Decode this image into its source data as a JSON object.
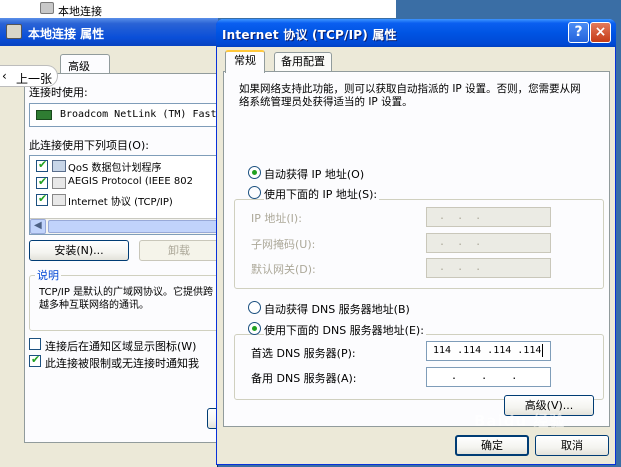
{
  "background_window": {
    "top_item": "本地连接",
    "title": "本地连接 属性",
    "back_button": "上一张",
    "tab_advanced": "高级",
    "connect_using_label": "连接时使用:",
    "adapter": "Broadcom NetLink (TM) Fast",
    "items_label": "此连接使用下列项目(O):",
    "items": [
      {
        "label": "QoS 数据包计划程序",
        "checked": true
      },
      {
        "label": "AEGIS Protocol (IEEE 802",
        "checked": true
      },
      {
        "label": "Internet 协议 (TCP/IP)",
        "checked": true
      }
    ],
    "install_button": "安装(N)...",
    "uninstall_button": "卸载",
    "description_group": "说明",
    "description_text": "TCP/IP 是默认的广域网协议。它提供跨越多种互联网络的通讯。",
    "show_icon_checkbox": "连接后在通知区域显示图标(W)",
    "notify_checkbox": "此连接被限制或无连接时通知我"
  },
  "dialog": {
    "title": "Internet 协议 (TCP/IP) 属性",
    "help_button": "?",
    "close_button": "×",
    "tabs": [
      "常规",
      "备用配置"
    ],
    "intro_text": "如果网络支持此功能，则可以获取自动指派的 IP 设置。否则，您需要从网络系统管理员处获得适当的 IP 设置。",
    "auto_ip_radio": "自动获得 IP 地址(O)",
    "manual_ip_radio": "使用下面的 IP 地址(S):",
    "ip_label": "IP 地址(I):",
    "subnet_label": "子网掩码(U):",
    "gateway_label": "默认网关(D):",
    "ip_value": " .  .  . ",
    "subnet_value": " .  .  . ",
    "gateway_value": " .  .  . ",
    "auto_dns_radio": "自动获得 DNS 服务器地址(B)",
    "manual_dns_radio": "使用下面的 DNS 服务器地址(E):",
    "preferred_dns_label": "首选 DNS 服务器(P):",
    "alternate_dns_label": "备用 DNS 服务器(A):",
    "preferred_dns_value": "114 .114 .114 .114",
    "alternate_dns_value": "   .    .    .   ",
    "advanced_button": "高级(V)...",
    "ok_button": "确定",
    "cancel_button": "取消",
    "ip_mode": "auto",
    "dns_mode": "manual"
  },
  "watermark": "Baidu 经验",
  "colors": {
    "titlebar_blue": "#0054e3",
    "face": "#ece9d8",
    "panel": "#fcfcfe",
    "group_title": "#0046d5",
    "check_green": "#21a121",
    "close_red": "#c53b17"
  }
}
